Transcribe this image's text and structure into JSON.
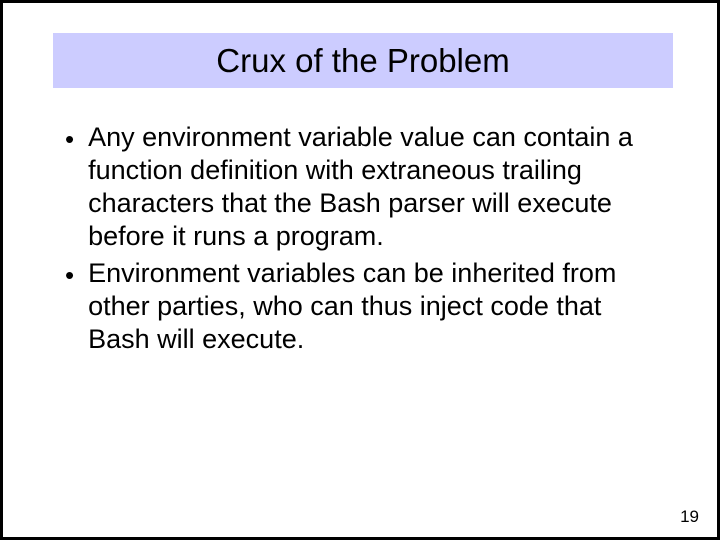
{
  "title": "Crux of the Problem",
  "bullets": [
    "Any environment variable value can contain a function definition with extraneous trailing characters that the Bash parser will execute before it runs a program.",
    "Environment variables can be inherited from other parties, who can thus inject code that Bash will execute."
  ],
  "page_number": "19"
}
